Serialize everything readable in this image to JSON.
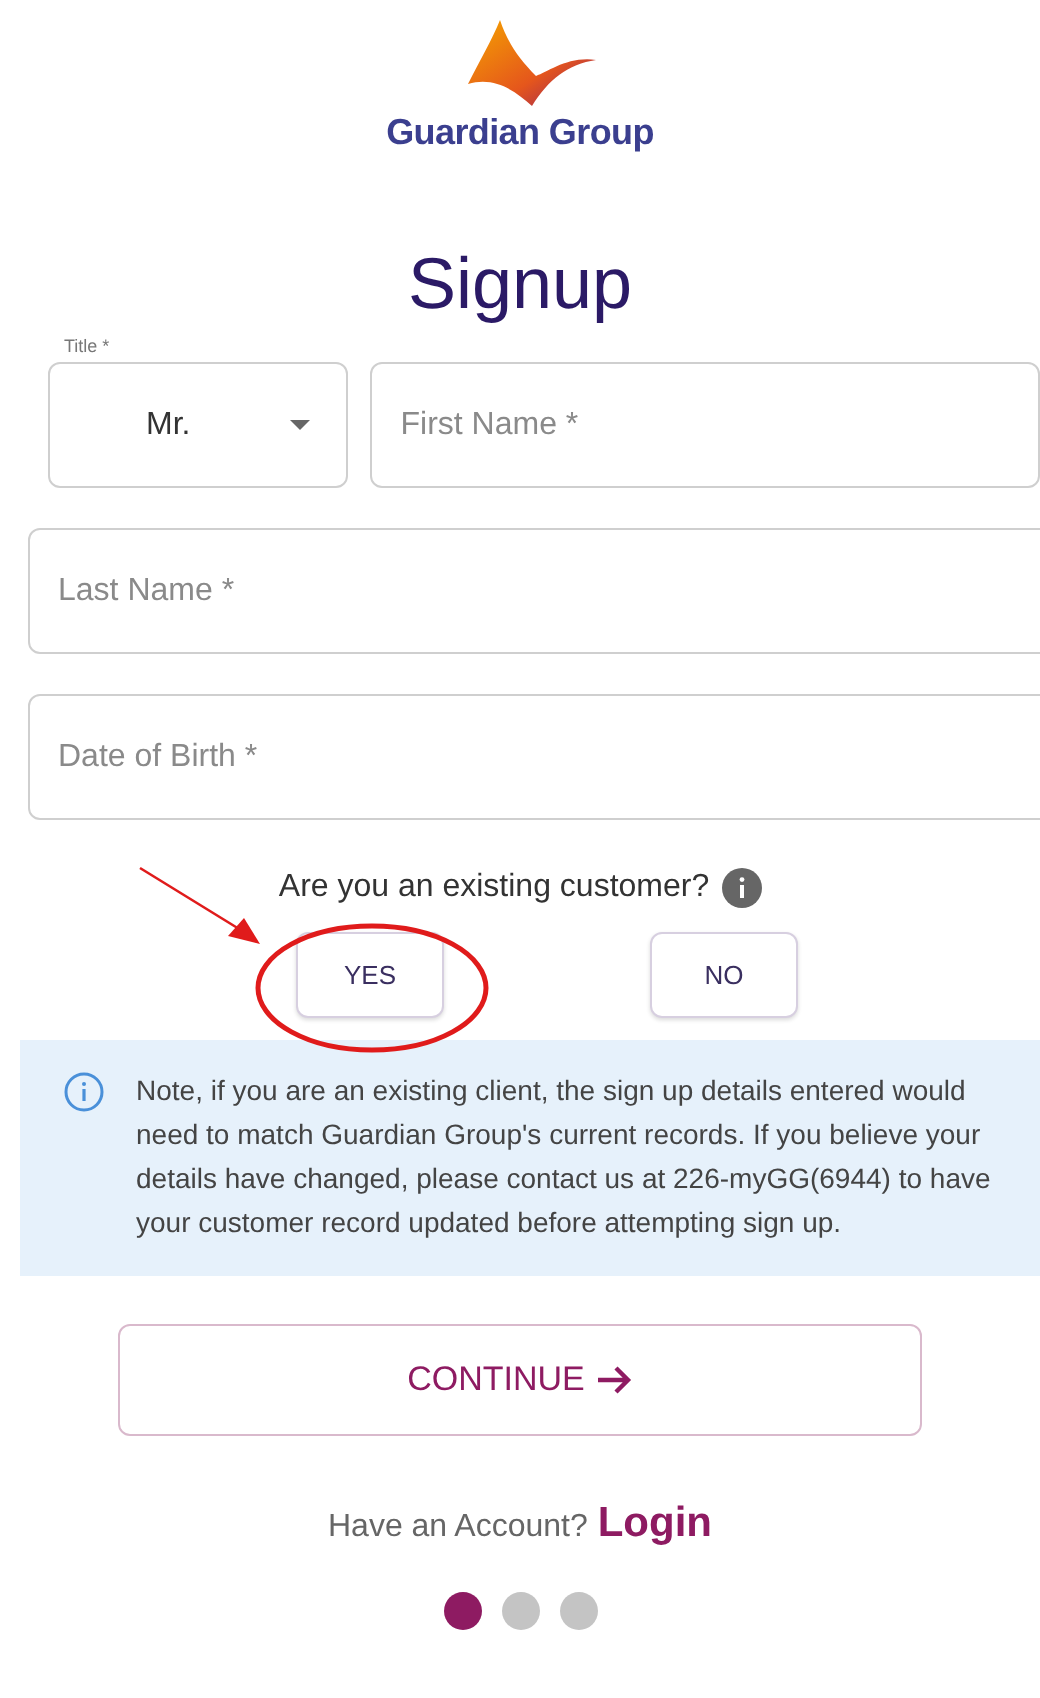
{
  "logo": {
    "text": "Guardian Group"
  },
  "title": "Signup",
  "form": {
    "title_select": {
      "label": "Title *",
      "value": "Mr."
    },
    "fields": [
      {
        "placeholder": "First Name *"
      },
      {
        "placeholder": "Last Name *"
      },
      {
        "placeholder": "Date of Birth *"
      }
    ]
  },
  "existing_customer": {
    "question": "Are you an existing customer?",
    "buttons": [
      "YES",
      "NO"
    ]
  },
  "note": "Note, if you are an existing client, the sign up details entered would need to match Guardian Group's current records. If you believe your details have changed, please contact us at 226-myGG(6944) to have your customer record updated before attempting sign up.",
  "continue_button": "CONTINUE",
  "login_prompt": {
    "text": "Have an Account?",
    "link": "Login"
  },
  "steps": [
    {
      "selected": true
    },
    {
      "selected": false
    },
    {
      "selected": false
    }
  ]
}
